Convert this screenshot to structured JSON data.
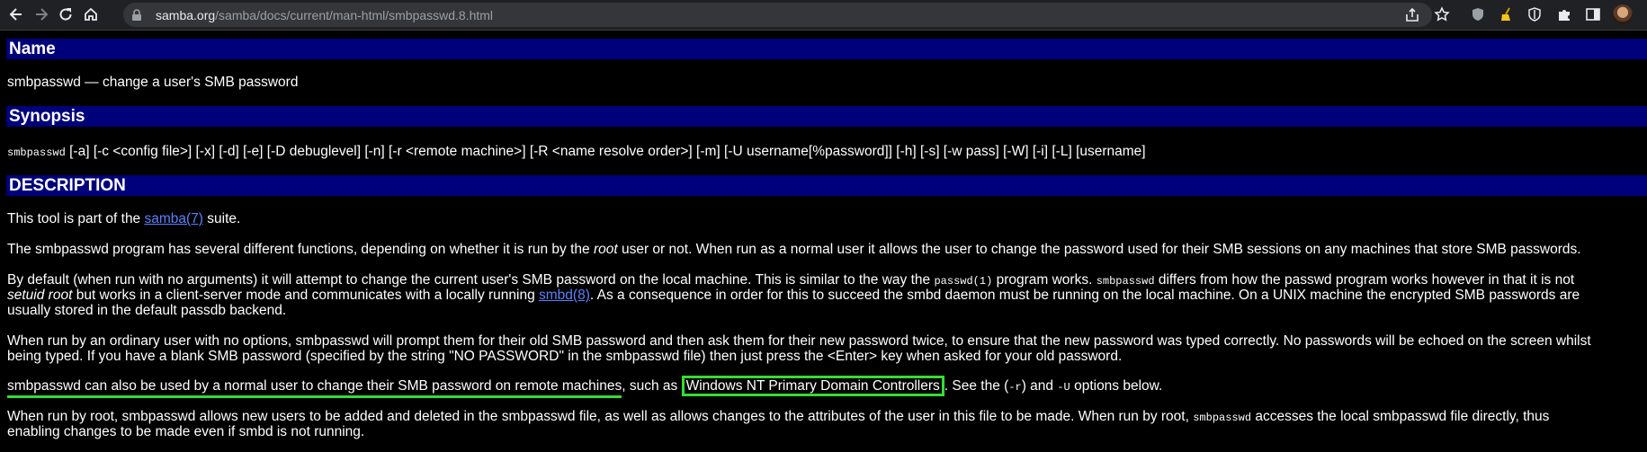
{
  "browser": {
    "url_host": "samba.org",
    "url_path": "/samba/docs/current/man-html/smbpasswd.8.html"
  },
  "icons": {
    "back": "back-arrow-icon",
    "forward": "forward-arrow-icon",
    "reload": "reload-icon",
    "home": "home-icon",
    "lock": "lock-icon",
    "share": "share-icon",
    "bookmark": "star-icon",
    "extensions": [
      "shield-extension-icon",
      "broom-extension-icon",
      "brave-shield-icon",
      "puzzle-extension-icon",
      "sidebar-icon"
    ],
    "profile": "profile-avatar"
  },
  "colors": {
    "header_bar": "#00007b",
    "link": "#5a80ff",
    "highlight": "#33dd33"
  },
  "sections": {
    "name_title": "Name",
    "name_text": "smbpasswd — change a user's SMB password",
    "synopsis_title": "Synopsis",
    "synopsis_cmd": "smbpasswd",
    "synopsis_args": " [-a] [-c <config file>] [-x] [-d] [-e] [-D debuglevel] [-n] [-r <remote machine>] [-R <name resolve order>] [-m] [-U username[%password]] [-h] [-s] [-w pass] [-W] [-i] [-L] [username]",
    "description_title": "DESCRIPTION"
  },
  "paragraphs": {
    "p1_a": "This tool is part of the ",
    "p1_link": "samba(7)",
    "p1_b": " suite.",
    "p2_a": "The smbpasswd program has several different functions, depending on whether it is run by the ",
    "p2_em": "root",
    "p2_b": " user or not. When run as a normal user it allows the user to change the password used for their SMB sessions on any machines that store SMB passwords.",
    "p3_l1_a": "By default (when run with no arguments) it will attempt to change the current user's SMB password on the local machine. This is similar to the way the ",
    "p3_l1_code1": "passwd(1)",
    "p3_l1_b": " program works. ",
    "p3_l1_code2": "smbpasswd",
    "p3_l1_c": " differs from how the passwd program works however in that it is not",
    "p3_l2_em": "setuid root",
    "p3_l2_a": " but works in a client-server mode and communicates with a locally running ",
    "p3_l2_link": "smbd(8)",
    "p3_l2_b": ". As a consequence in order for this to succeed the smbd daemon must be running on the local machine. On a UNIX machine the encrypted SMB passwords are",
    "p3_l3": "usually stored in the default passdb backend.",
    "p4_l1": "When run by an ordinary user with no options, smbpasswd will prompt them for their old SMB password and then ask them for their new password twice, to ensure that the new password was typed correctly. No passwords will be echoed on the screen whilst",
    "p4_l2": "being typed. If you have a blank SMB password (specified by the string \"NO PASSWORD\" in the smbpasswd file) then just press the <Enter> key when asked for your old password.",
    "p5_underlined": "smbpasswd can also be used by a normal user to change their SMB password on remote machines",
    "p5_a": ", such as ",
    "p5_boxed": "Windows NT Primary Domain Controllers",
    "p5_b": ". See the (",
    "p5_code1": "-r",
    "p5_c": ") and ",
    "p5_code2": "-U",
    "p5_d": " options below.",
    "p6_l1_a": "When run by root, smbpasswd allows new users to be added and deleted in the smbpasswd file, as well as allows changes to the attributes of the user in this file to be made. When run by root, ",
    "p6_l1_code": "smbpasswd",
    "p6_l1_b": " accesses the local smbpasswd file directly, thus",
    "p6_l2": "enabling changes to be made even if smbd is not running."
  }
}
